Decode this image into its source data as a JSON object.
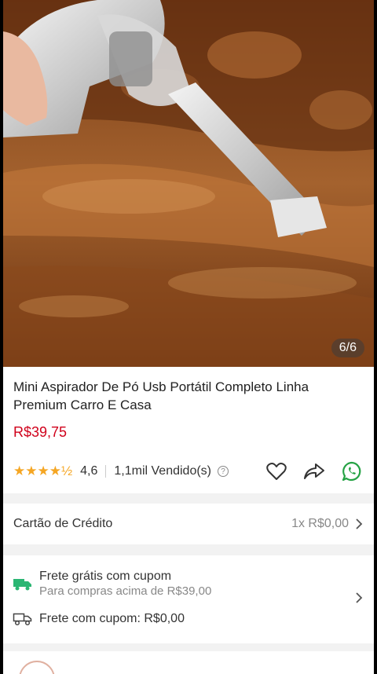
{
  "image": {
    "counter": "6/6"
  },
  "product": {
    "title": "Mini Aspirador De Pó Usb Portátil Completo Linha Premium Carro E Casa",
    "price": "R$39,75",
    "stars": "★★★★½",
    "rating": "4,6",
    "sold": "1,1mil Vendido(s)",
    "help_mark": "?"
  },
  "payment": {
    "label": "Cartão de Crédito",
    "value": "1x R$0,00"
  },
  "shipping": {
    "free_title": "Frete grátis com cupom",
    "free_subtitle": "Para compras acima de R$39,00",
    "coupon_line": "Frete com cupom: R$0,00"
  },
  "colors": {
    "price": "#d0011b",
    "stars": "#f5a623",
    "whatsapp": "#25a244",
    "truck_green": "#2bb673"
  }
}
